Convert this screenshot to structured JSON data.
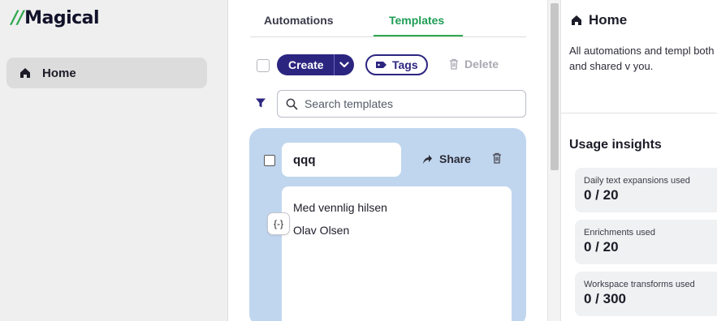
{
  "sidebar": {
    "logo_slashes": "//",
    "logo_text": "Magical",
    "nav_items": [
      {
        "icon": "home-icon",
        "label": "Home"
      }
    ]
  },
  "tabs": [
    {
      "label": "Automations",
      "active": false
    },
    {
      "label": "Templates",
      "active": true
    }
  ],
  "toolbar": {
    "create_label": "Create",
    "tags_label": "Tags",
    "delete_label": "Delete"
  },
  "search": {
    "placeholder": "Search templates",
    "value": ""
  },
  "template_card": {
    "title": "qqq",
    "share_label": "Share",
    "body_lines": [
      "Med vennlig hilsen",
      "Olav Olsen"
    ],
    "variable_icon": "{-}"
  },
  "right_panel": {
    "title": "Home",
    "description": "All automations and templ both personal and shared v you.",
    "usage_title": "Usage insights",
    "stats": [
      {
        "label": "Daily text expansions used",
        "value": "0 / 20"
      },
      {
        "label": "Enrichments used",
        "value": "0 / 20"
      },
      {
        "label": "Workspace transforms used",
        "value": "0 / 300"
      }
    ]
  },
  "colors": {
    "brand_green": "#2fa84f",
    "primary_navy": "#2c2580",
    "card_blue": "#c0d6ee",
    "sidebar_bg": "#efefef"
  }
}
